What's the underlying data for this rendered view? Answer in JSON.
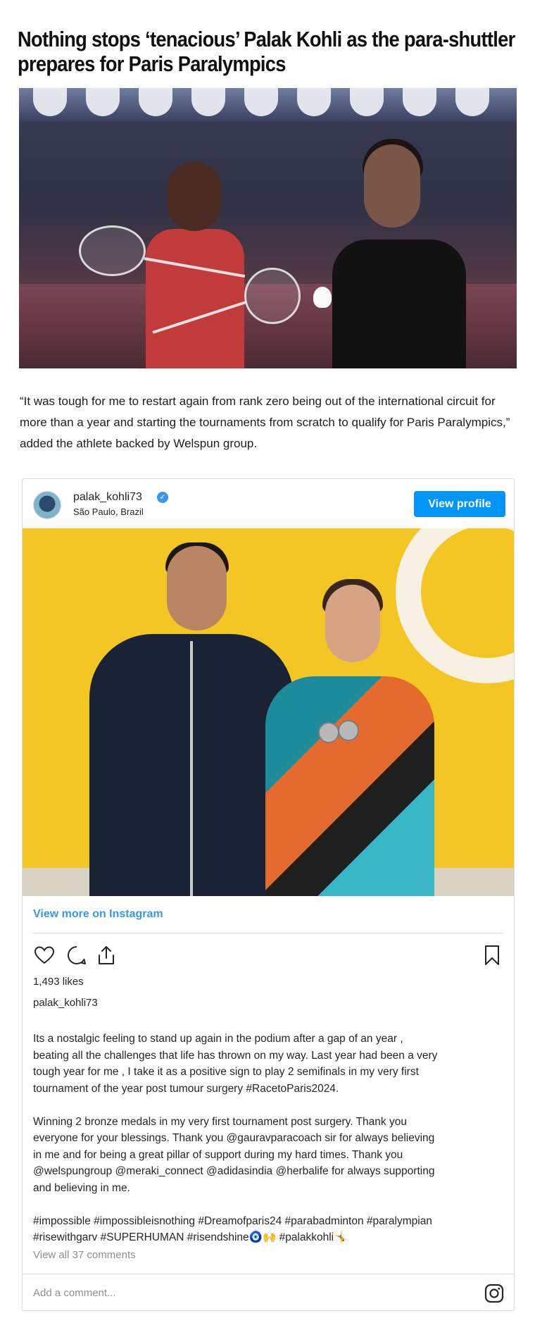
{
  "article": {
    "headline_line1": "Nothing stops ‘tenacious’ Palak Kohli as the para-shuttler",
    "headline_line2": "prepares for Paris Paralympics",
    "paragraph": "“It was tough for me to restart again from rank zero being out of the international circuit for more than a year and starting the tournaments from scratch to qualify for Paris Paralympics,” added the athlete backed by Welspun group."
  },
  "instagram": {
    "username": "palak_kohli73",
    "location": "São Paulo, Brazil",
    "view_profile": "View profile",
    "view_more": "View more on Instagram",
    "likes": "1,493 likes",
    "caption_user": "palak_kohli73",
    "caption": "Its a nostalgic feeling to stand up again in the podium after a gap of an year ,\nbeating all the challenges that life has thrown on my way. Last year had been a very\ntough year for me , I take it as a positive sign to play 2 semifinals in my very first\ntournament of the year post tumour surgery #RacetoParis2024.\n\nWinning 2 bronze medals in my very first tournament post surgery. Thank you\neveryone for your blessings. Thank you @gauravparacoach sir for always believing\nin me and for being a great pillar of support during my hard times. Thank you\n@welspungroup @meraki_connect @adidasindia @herbalife for always supporting\nand believing in me.\n\n#impossible #impossibleisnothing #Dreamofparis24 #parabadminton #paralympian\n#risewithgarv #SUPERHUMAN #risendshine🧿🙌 #palakkohli🤸",
    "view_comments": "View all 37 comments",
    "comment_placeholder": "Add a comment...",
    "accent": "#0095f6",
    "link_color": "#3897f0"
  },
  "icons": {
    "like": "heart-icon",
    "comment": "comment-icon",
    "share": "share-icon",
    "save": "bookmark-icon",
    "verified": "verified-badge-icon",
    "logo": "instagram-logo-icon"
  }
}
